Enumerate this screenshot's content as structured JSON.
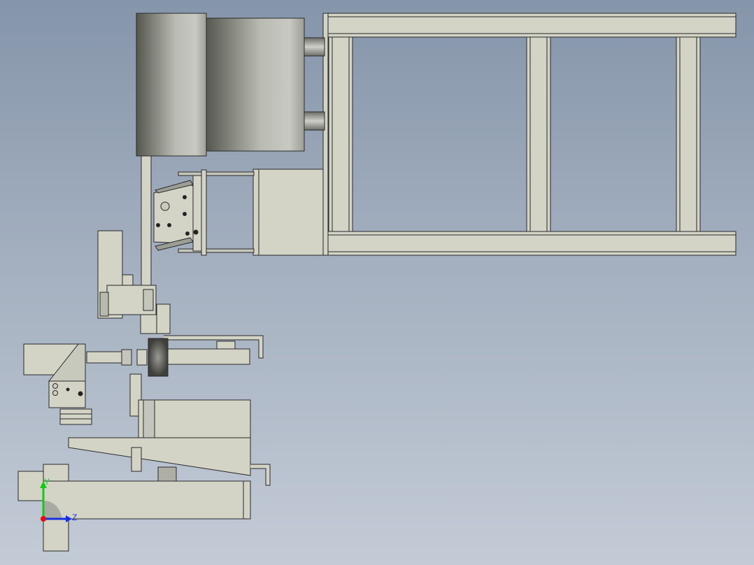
{
  "viewport": {
    "background_top": "#8595aa",
    "background_bottom": "#c3cbd6",
    "part_fill": "#d3d3c6",
    "part_edge": "#2a2a2a",
    "motor_dark": "#55574f",
    "motor_light": "#c2c3bc"
  },
  "triad": {
    "x_axis_color": "#e01010",
    "y_axis_color": "#18c818",
    "z_axis_color": "#1830e0",
    "y_label": "Y",
    "z_label": "Z"
  }
}
